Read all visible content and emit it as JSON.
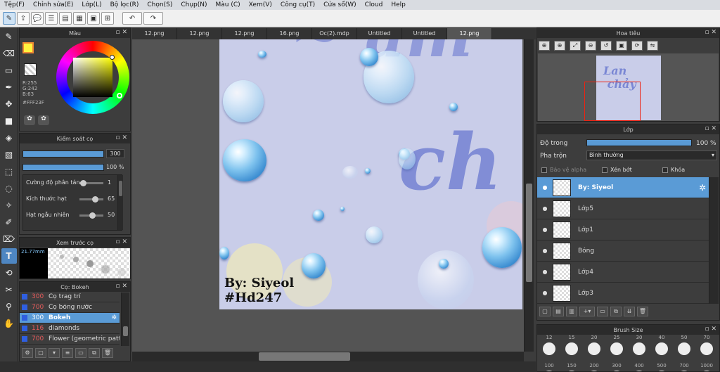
{
  "menu": [
    "Tệp(F)",
    "Chỉnh sửa(E)",
    "Lớp(L)",
    "Bộ lọc(R)",
    "Chọn(S)",
    "Chụp(N)",
    "Màu (C)",
    "Xem(V)",
    "Công cụ(T)",
    "Cửa sổ(W)",
    "Cloud",
    "Help"
  ],
  "color_panel": {
    "title": "Màu",
    "r": "R:255",
    "g": "G:242",
    "b": "B:63",
    "hex": "#FFF23F",
    "fg_color": "#fff23f"
  },
  "brush_control": {
    "title": "Kiểm soát cọ",
    "size": "300",
    "opacity": "100 %",
    "params": [
      {
        "label": "Cường độ phân tán",
        "value": "1",
        "level": 0.02
      },
      {
        "label": "Kích thước hạt",
        "value": "65",
        "level": 0.65
      },
      {
        "label": "Hạt ngẫu nhiên",
        "value": "50",
        "level": 0.5
      }
    ]
  },
  "preview": {
    "title": "Xem trước cọ",
    "size": "21.77mm"
  },
  "brush_list": {
    "title": "Cọ: Bokeh",
    "items": [
      {
        "num": "300",
        "name": "Cọ trag trí",
        "selected": false
      },
      {
        "num": "700",
        "name": "Cọ bóng nước",
        "selected": false
      },
      {
        "num": "300",
        "name": "Bokeh",
        "selected": true
      },
      {
        "num": "116",
        "name": "diamonds",
        "selected": false
      },
      {
        "num": "700",
        "name": "Flower (geometric patte",
        "selected": false
      }
    ]
  },
  "tabs": [
    {
      "label": "12.png",
      "active": false
    },
    {
      "label": "12.png",
      "active": false
    },
    {
      "label": "12.png",
      "active": false
    },
    {
      "label": "16.png",
      "active": false
    },
    {
      "label": "Oc(2).mdp",
      "active": false
    },
    {
      "label": "Untitled",
      "active": false
    },
    {
      "label": "Untitled",
      "active": false
    },
    {
      "label": "12.png",
      "active": true
    }
  ],
  "canvas": {
    "signature_1": "By: Siyeol",
    "signature_2": "#Hd247"
  },
  "navigator": {
    "title": "Hoa tiêu"
  },
  "layers": {
    "title": "Lớp",
    "opacity_label": "Độ trong",
    "opacity_value": "100 %",
    "blend_label": "Pha trộn",
    "blend_value": "Bình thường",
    "protect_alpha": "Bảo vệ alpha",
    "clip": "Xén bớt",
    "lock": "Khóa",
    "items": [
      {
        "name": "By: Siyeol",
        "selected": true
      },
      {
        "name": "Lớp5",
        "selected": false
      },
      {
        "name": "Lớp1",
        "selected": false
      },
      {
        "name": "Bóng",
        "selected": false
      },
      {
        "name": "Lớp4",
        "selected": false
      },
      {
        "name": "Lớp3",
        "selected": false
      }
    ]
  },
  "brush_size": {
    "title": "Brush Size",
    "values": [
      "12",
      "15",
      "20",
      "25",
      "30",
      "40",
      "50",
      "70",
      "100",
      "150",
      "200",
      "300",
      "400",
      "500",
      "700",
      "1000"
    ]
  }
}
